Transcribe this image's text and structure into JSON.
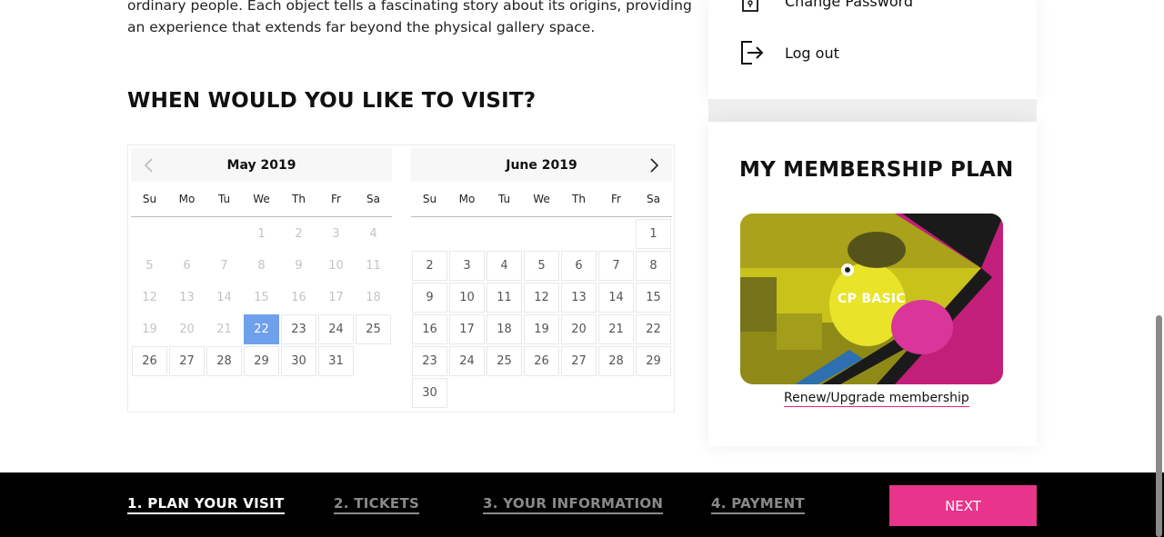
{
  "intro": {
    "line1": "ordinary people. Each object tells a fascinating story about its origins, providing",
    "line2": "an experience that extends far beyond the physical gallery space."
  },
  "visit": {
    "heading": "WHEN WOULD YOU LIKE TO VISIT?"
  },
  "calendar": {
    "weekdays": [
      "Su",
      "Mo",
      "Tu",
      "We",
      "Th",
      "Fr",
      "Sa"
    ],
    "months": [
      {
        "title": "May 2019",
        "offset": 3,
        "days": 31,
        "past_until": 21,
        "selected": 22
      },
      {
        "title": "June 2019",
        "offset": 6,
        "days": 30,
        "past_until": 0,
        "selected": null
      }
    ]
  },
  "account_menu": {
    "change_password": "Change Password",
    "logout": "Log out"
  },
  "membership": {
    "heading": "MY MEMBERSHIP PLAN",
    "card_label": "CP BASIC",
    "renew_link": "Renew/Upgrade membership"
  },
  "steps": {
    "step1": "1. PLAN YOUR VISIT",
    "step2": "2. TICKETS",
    "step3": "3. YOUR INFORMATION",
    "step4": "4. PAYMENT"
  },
  "next_button": "NEXT",
  "colors": {
    "accent_pink": "#e8348a",
    "selected_day": "#6ea0ec",
    "card_yellow": "#cfc81a",
    "card_magenta": "#c21f7a"
  },
  "icons": [
    "chevron-left-icon",
    "chevron-right-icon",
    "lock-icon",
    "logout-icon"
  ]
}
